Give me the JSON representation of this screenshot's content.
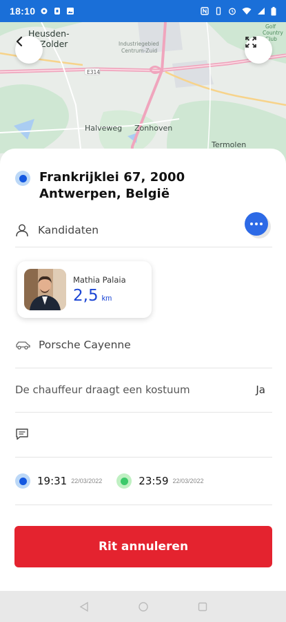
{
  "status_bar": {
    "time": "18:10"
  },
  "map": {
    "labels": {
      "heusden": "Heusden-",
      "zolder": "Zolder",
      "industry1": "Industriegebied",
      "industry2": "Centrum-Zuid",
      "highway": "E314",
      "halveweg": "Halveweg",
      "zonhoven": "Zonhoven",
      "termolen": "Termolen",
      "club1": "Golf",
      "club2": "Country",
      "club3": "Club"
    }
  },
  "trip": {
    "address": "Frankrijklei 67, 2000 Antwerpen, België",
    "candidates_label": "Kandidaten",
    "driver": {
      "name": "Mathia Palaia",
      "distance": "2,5",
      "unit": "km"
    },
    "car": "Porsche Cayenne",
    "suit_question": "De chauffeur draagt een kostuum",
    "suit_answer": "Ja",
    "start_time": "19:31",
    "start_date": "22/03/2022",
    "end_time": "23:59",
    "end_date": "22/03/2022"
  },
  "actions": {
    "cancel_label": "Rit annuleren"
  },
  "colors": {
    "accent": "#1a6fd8",
    "cancel": "#e4232f",
    "distance": "#1b45d4"
  }
}
